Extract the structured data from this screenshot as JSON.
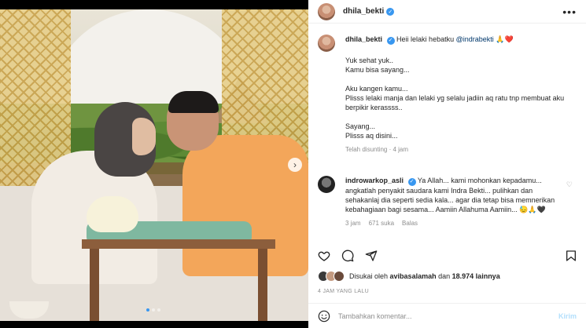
{
  "post": {
    "author": "dhila_bekti",
    "caption": {
      "author": "dhila_bekti",
      "intro": "Heii lelaki hebatku",
      "mention": "@indrabekti",
      "emojis": "🙏❤️",
      "lines": [
        "Yuk sehat yuk..",
        "Kamu bisa sayang...",
        "",
        "Aku kangen kamu...",
        "Plisss lelaki manja dan lelaki yg selalu jadiin aq ratu tnp membuat aku berpikir kerassss..",
        "",
        "Sayang...",
        "Plisss aq disini..."
      ],
      "meta": "Telah disunting · 4 jam"
    },
    "comment": {
      "author": "indrowarkop_asli",
      "text": "Ya Allah... kami mohonkan kepadamu... angkatlah penyakit saudara kami Indra Bekti... pulihkan dan sehakanlaj dia seperti sedia kala... agar dia tetap bisa memnerikan kebahagiaan bagi sesama... Aamiin Allahuma Aamiin... 😓🙏🖤",
      "time": "3 jam",
      "likes": "671 suka",
      "reply": "Balas"
    },
    "likes": {
      "prefix": "Disukai oleh",
      "user": "avibasalamah",
      "middle": "dan",
      "count": "18.974 lainnya"
    },
    "timestamp": "4 JAM YANG LALU",
    "comment_input": {
      "placeholder": "Tambahkan komentar...",
      "post_label": "Kirim"
    },
    "icons": [
      "heart-icon",
      "comment-icon",
      "share-icon",
      "bookmark-icon",
      "emoji-icon",
      "more-icon",
      "verified-icon"
    ]
  },
  "carousel": {
    "slides": 3,
    "active": 1
  }
}
